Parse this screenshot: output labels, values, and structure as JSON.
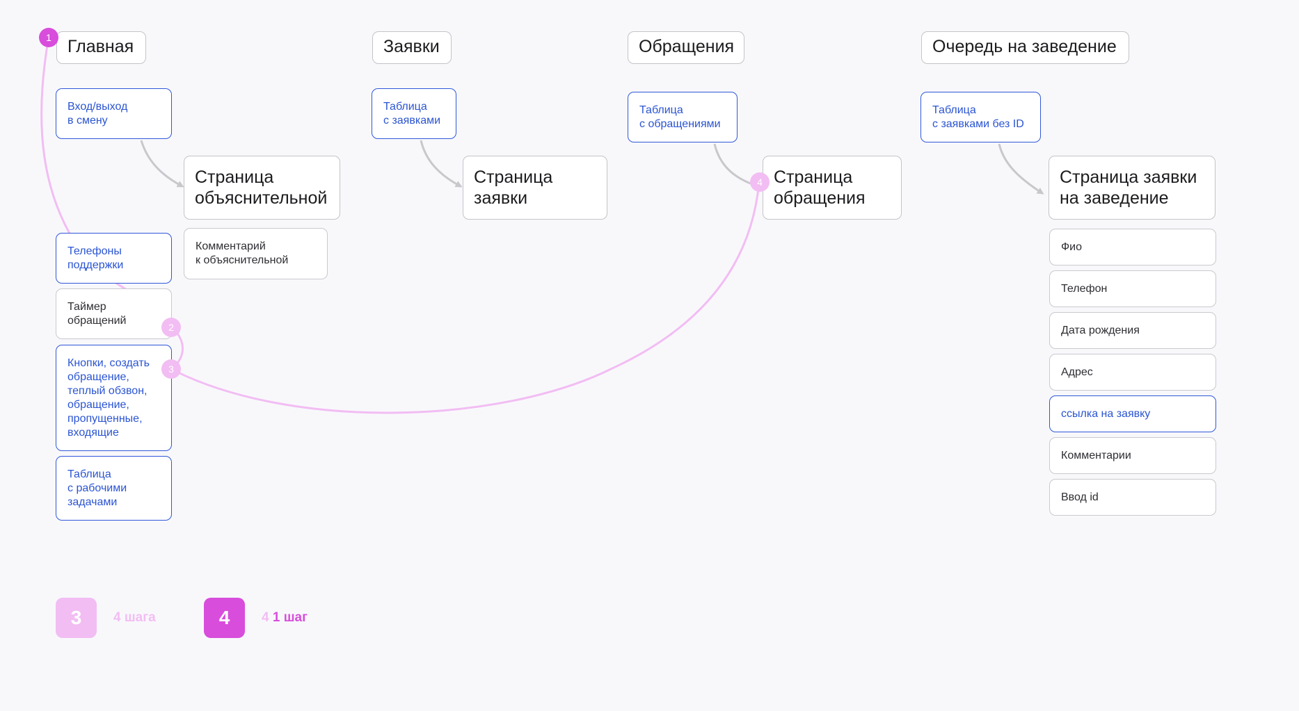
{
  "colors": {
    "accent": "#d84ddb",
    "accent_light": "#f2bdf3",
    "link_blue": "#2a54d2",
    "arrow_gray": "#c8c8cc"
  },
  "sections": {
    "main": {
      "title": "Главная",
      "items": {
        "shift": "Вход/выход\nв смену",
        "phones": "Телефоны\nподдержки",
        "timer": "Таймер\nобращений",
        "buttons": "Кнопки, создать\nобращение,\nтеплый обзвон,\nобращение,\nпропущенные,\nвходящие",
        "tasks": "Таблица\nс рабочими\nзадачами"
      },
      "page": "Страница\nобъяснительной",
      "page_items": {
        "comment": "Комментарий\nк объяснительной"
      }
    },
    "requests": {
      "title": "Заявки",
      "table": "Таблица\nс заявками",
      "page": "Страница\nзаявки"
    },
    "appeals": {
      "title": "Обращения",
      "table": "Таблица\nс обращениями",
      "page": "Страница\nобращения"
    },
    "queue": {
      "title": "Очередь на заведение",
      "table": "Таблица\nс заявками без ID",
      "page": "Страница заявки\nна заведение",
      "fields": {
        "fio": "Фио",
        "phone": "Телефон",
        "birth": "Дата рождения",
        "address": "Адрес",
        "link": "ссылка на заявку",
        "comments": "Комментарии",
        "id_input": "Ввод id"
      }
    }
  },
  "steps": {
    "s1": "1",
    "s2": "2",
    "s3": "3",
    "s4": "4"
  },
  "legend": {
    "a": {
      "badge": "3",
      "text": "4 шага"
    },
    "b": {
      "badge": "4",
      "prefix": "4",
      "text": "1 шаг"
    }
  }
}
